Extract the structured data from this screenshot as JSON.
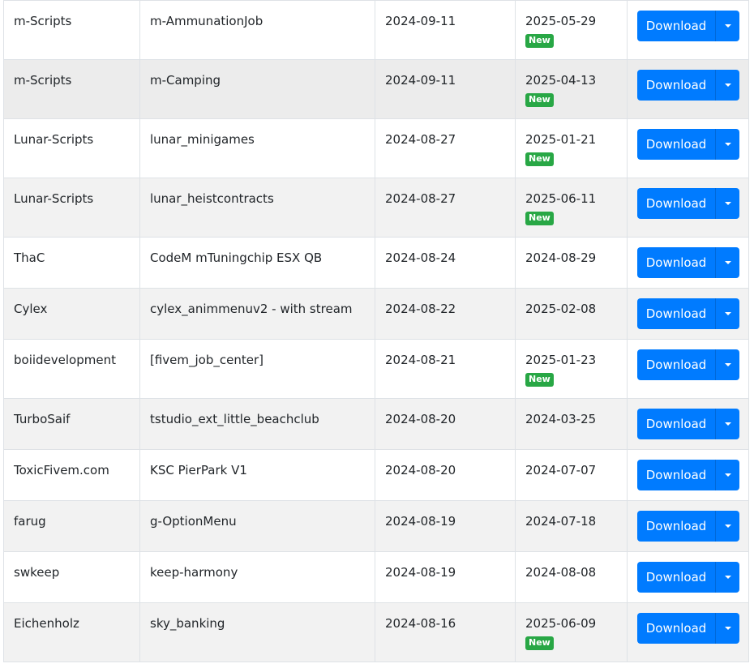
{
  "download_label": "Download",
  "new_badge": "New",
  "rows": [
    {
      "author": "m-Scripts",
      "name": "m-AmmunationJob",
      "created": "2024-09-11",
      "updated": "2025-05-29",
      "is_new": true
    },
    {
      "author": "m-Scripts",
      "name": "m-Camping",
      "created": "2024-09-11",
      "updated": "2025-04-13",
      "is_new": true
    },
    {
      "author": "Lunar-Scripts",
      "name": "lunar_minigames",
      "created": "2024-08-27",
      "updated": "2025-01-21",
      "is_new": true
    },
    {
      "author": "Lunar-Scripts",
      "name": "lunar_heistcontracts",
      "created": "2024-08-27",
      "updated": "2025-06-11",
      "is_new": true
    },
    {
      "author": "ThaC",
      "name": "CodeM mTuningchip ESX QB",
      "created": "2024-08-24",
      "updated": "2024-08-29",
      "is_new": false
    },
    {
      "author": "Cylex",
      "name": "cylex_animmenuv2 - with stream",
      "created": "2024-08-22",
      "updated": "2025-02-08",
      "is_new": false
    },
    {
      "author": "boiidevelopment",
      "name": "[fivem_job_center]",
      "created": "2024-08-21",
      "updated": "2025-01-23",
      "is_new": true
    },
    {
      "author": "TurboSaif",
      "name": "tstudio_ext_little_beachclub",
      "created": "2024-08-20",
      "updated": "2024-03-25",
      "is_new": false
    },
    {
      "author": "ToxicFivem.com",
      "name": "KSC PierPark V1",
      "created": "2024-08-20",
      "updated": "2024-07-07",
      "is_new": false
    },
    {
      "author": "farug",
      "name": "g-OptionMenu",
      "created": "2024-08-19",
      "updated": "2024-07-18",
      "is_new": false
    },
    {
      "author": "swkeep",
      "name": "keep-harmony",
      "created": "2024-08-19",
      "updated": "2024-08-08",
      "is_new": false
    },
    {
      "author": "Eichenholz",
      "name": "sky_banking",
      "created": "2024-08-16",
      "updated": "2025-06-09",
      "is_new": true
    }
  ]
}
